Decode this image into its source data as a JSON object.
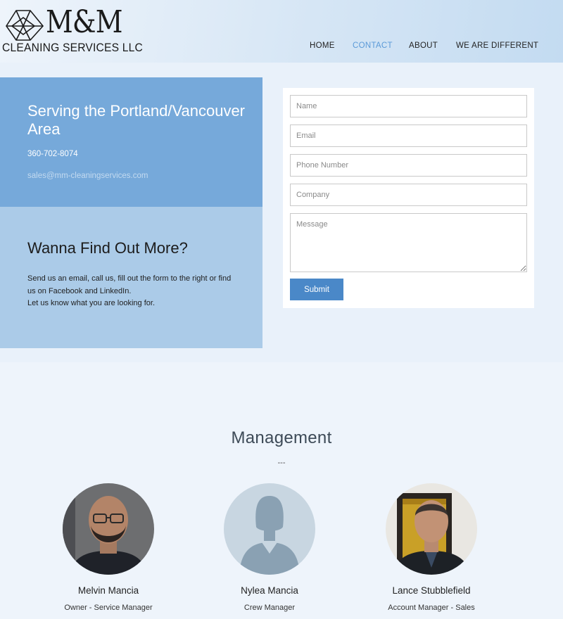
{
  "brand": {
    "logo_mark": "M&M",
    "logo_sub": "CLEANING SERVICES LLC"
  },
  "nav": {
    "items": [
      {
        "label": "HOME",
        "active": false
      },
      {
        "label": "CONTACT",
        "active": true
      },
      {
        "label": "ABOUT",
        "active": false
      },
      {
        "label": "WE ARE DIFFERENT",
        "active": false
      }
    ]
  },
  "contact_info": {
    "heading": "Serving the Portland/Vancouver Area",
    "phone": "360-702-8074",
    "email": "sales@mm-cleaningservices.com"
  },
  "more": {
    "heading": "Wanna Find Out More?",
    "line1": "Send us an email, call us, fill out the form to the right or find us on Facebook and LinkedIn.",
    "line2": "Let us know what you are looking for."
  },
  "form": {
    "name_placeholder": "Name",
    "email_placeholder": "Email",
    "phone_placeholder": "Phone Number",
    "company_placeholder": "Company",
    "message_placeholder": "Message",
    "submit_label": "Submit"
  },
  "management": {
    "title": "Management",
    "divider": "---",
    "people": [
      {
        "name": "Melvin Mancia",
        "role": "Owner - Service Manager",
        "avatar": "photo"
      },
      {
        "name": "Nylea Mancia",
        "role": "Crew Manager",
        "avatar": "placeholder-silhouette-icon"
      },
      {
        "name": "Lance Stubblefield",
        "role": "Account Manager - Sales",
        "avatar": "photo"
      }
    ]
  },
  "colors": {
    "accent": "#5b9ad8",
    "panel_dark": "#76a9da",
    "panel_light": "#abcbe8",
    "button": "#4a88c8"
  }
}
